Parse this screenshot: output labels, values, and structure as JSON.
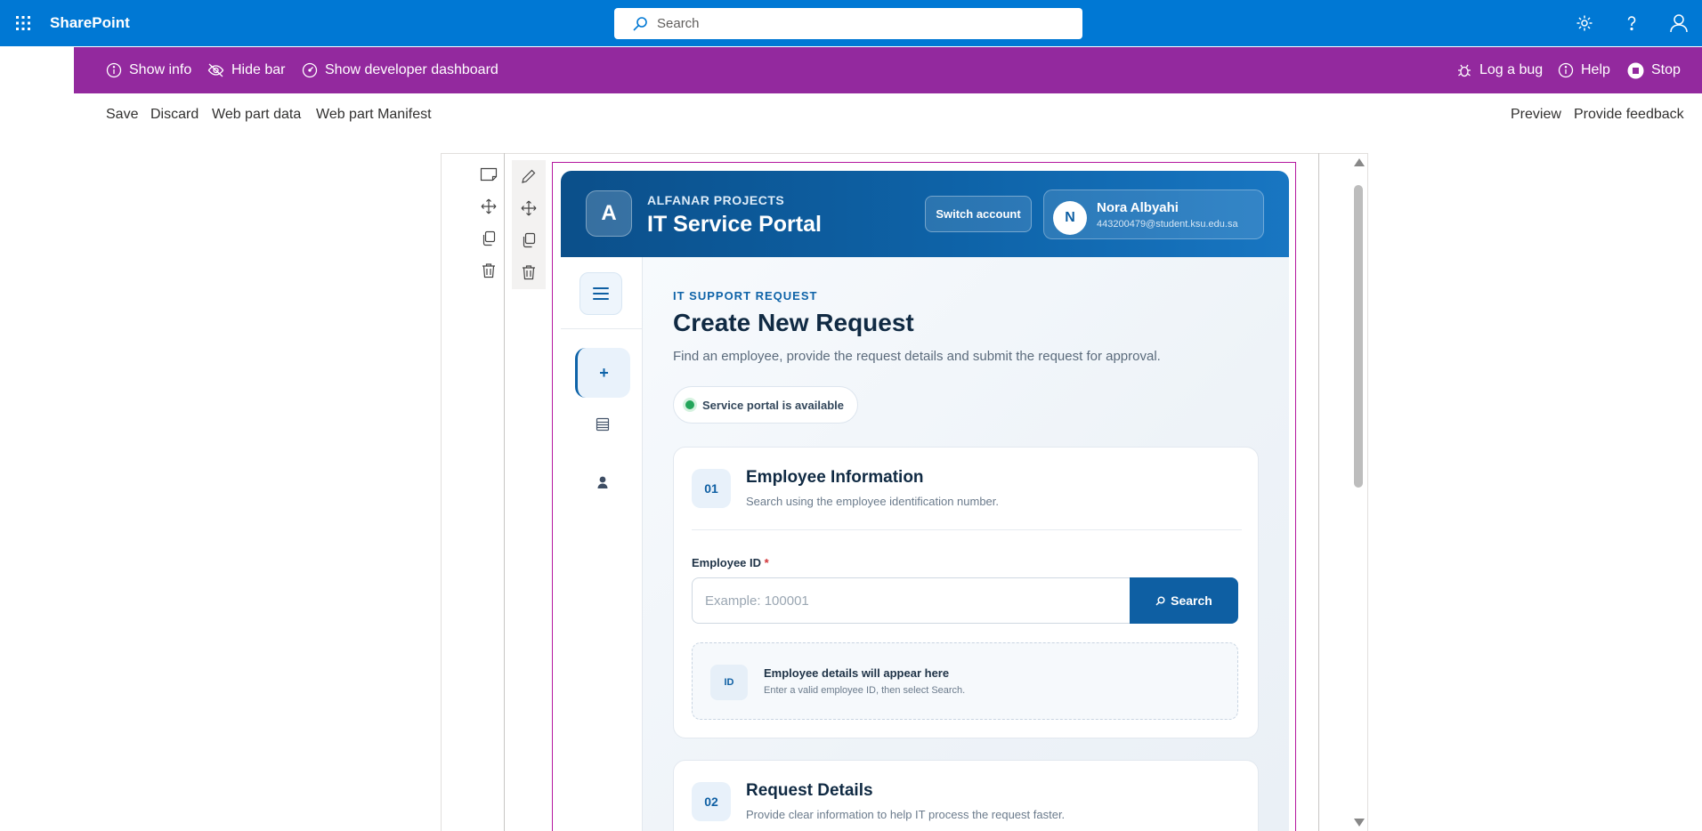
{
  "suite": {
    "brand": "SharePoint",
    "search_placeholder": "Search"
  },
  "workbench": {
    "show_info": "Show info",
    "hide_bar": "Hide bar",
    "dev_dashboard": "Show developer dashboard",
    "log_bug": "Log a bug",
    "help": "Help",
    "stop": "Stop"
  },
  "commands": {
    "save": "Save",
    "discard": "Discard",
    "webpart_data": "Web part data",
    "webpart_manifest": "Web part Manifest",
    "preview": "Preview",
    "feedback": "Provide feedback"
  },
  "portal": {
    "logo_letter": "A",
    "org": "ALFANAR PROJECTS",
    "title": "IT Service Portal",
    "switch_account": "Switch account",
    "user_initial": "N",
    "user_name": "Nora Albyahi",
    "user_email": "443200479@student.ksu.edu.sa",
    "nav_new": "+",
    "eyebrow": "IT SUPPORT REQUEST",
    "heading": "Create New Request",
    "lead": "Find an employee, provide the request details and submit the request for approval.",
    "status": "Service portal is available",
    "status_color": "#23a55a",
    "accent": "#0e5fa3",
    "section1": {
      "number": "01",
      "title": "Employee Information",
      "subtitle": "Search using the employee identification number.",
      "field_label": "Employee ID",
      "required_mark": "*",
      "placeholder": "Example: 100001",
      "search_button": "Search",
      "empty_badge": "ID",
      "empty_title": "Employee details will appear here",
      "empty_sub": "Enter a valid employee ID, then select Search."
    },
    "section2": {
      "number": "02",
      "title": "Request Details",
      "subtitle": "Provide clear information to help IT process the request faster."
    }
  }
}
